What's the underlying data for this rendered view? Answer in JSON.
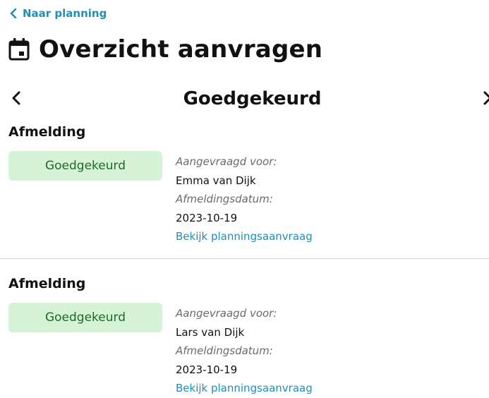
{
  "nav": {
    "back_label": "Naar planning"
  },
  "page": {
    "title": "Overzicht aanvragen"
  },
  "pager": {
    "current_status": "Goedgekeurd"
  },
  "requests": [
    {
      "type": "Afmelding",
      "status": "Goedgekeurd",
      "requested_for_label": "Aangevraagd voor:",
      "requested_for": "Emma van Dijk",
      "date_label": "Afmeldingsdatum:",
      "date": "2023-10-19",
      "link": "Bekijk planningsaanvraag"
    },
    {
      "type": "Afmelding",
      "status": "Goedgekeurd",
      "requested_for_label": "Aangevraagd voor:",
      "requested_for": "Lars van Dijk",
      "date_label": "Afmeldingsdatum:",
      "date": "2023-10-19",
      "link": "Bekijk planningsaanvraag"
    }
  ],
  "colors": {
    "accent": "#1f8fb5",
    "approved_bg": "#d6f3d8",
    "approved_text": "#1d6b23"
  },
  "icons": [
    "chevron-left-icon",
    "calendar-icon",
    "chevron-right-icon"
  ]
}
